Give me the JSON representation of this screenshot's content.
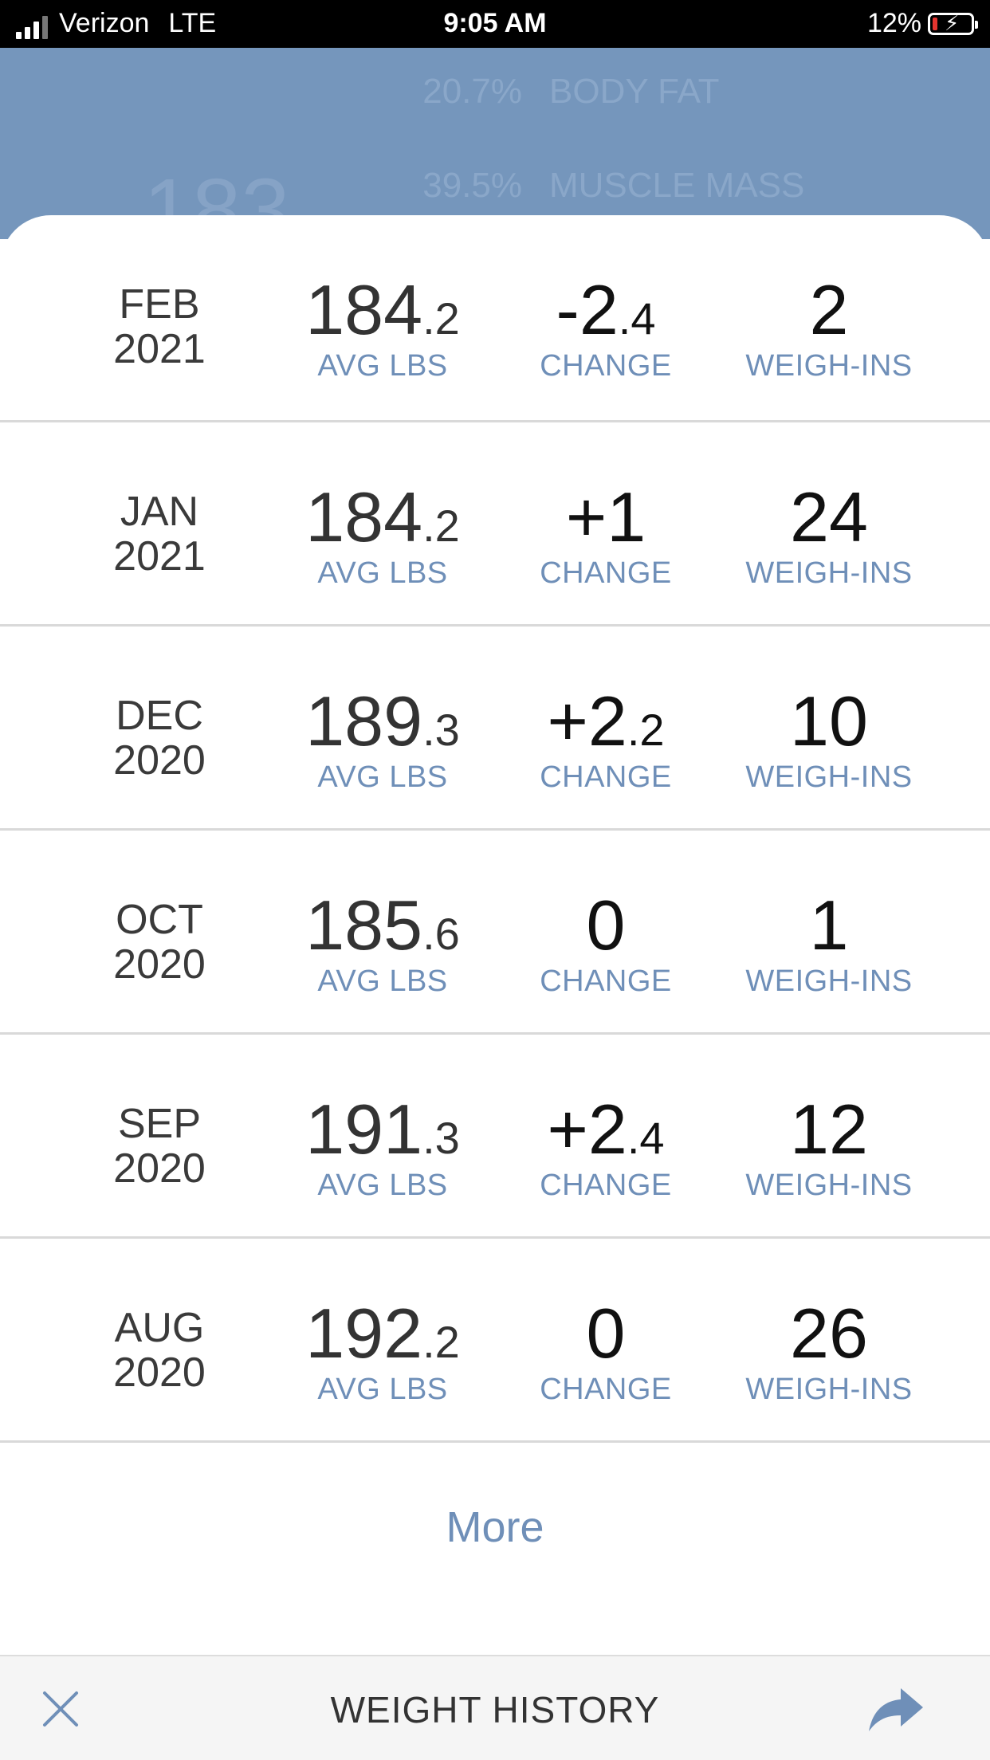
{
  "status_bar": {
    "carrier": "Verizon",
    "network": "LTE",
    "time": "9:05 AM",
    "battery": "12%",
    "icons": [
      "signal-icon",
      "battery-charging-icon"
    ]
  },
  "header": {
    "body_fat_pct": "20.7%",
    "body_fat_label": "BODY FAT",
    "muscle_mass_pct": "39.5%",
    "muscle_mass_label": "MUSCLE MASS",
    "current_weight": "183"
  },
  "history": {
    "avg_label": "AVG LBS",
    "change_label": "CHANGE",
    "weighins_label": "WEIGH-INS",
    "rows": [
      {
        "month": "FEB",
        "year": "2021",
        "avg_int": "184",
        "avg_dec": ".2",
        "change_int": "-2",
        "change_dec": ".4",
        "weighins": "2"
      },
      {
        "month": "JAN",
        "year": "2021",
        "avg_int": "184",
        "avg_dec": ".2",
        "change_int": "+1",
        "change_dec": "",
        "weighins": "24"
      },
      {
        "month": "DEC",
        "year": "2020",
        "avg_int": "189",
        "avg_dec": ".3",
        "change_int": "+2",
        "change_dec": ".2",
        "weighins": "10"
      },
      {
        "month": "OCT",
        "year": "2020",
        "avg_int": "185",
        "avg_dec": ".6",
        "change_int": "0",
        "change_dec": "",
        "weighins": "1"
      },
      {
        "month": "SEP",
        "year": "2020",
        "avg_int": "191",
        "avg_dec": ".3",
        "change_int": "+2",
        "change_dec": ".4",
        "weighins": "12"
      },
      {
        "month": "AUG",
        "year": "2020",
        "avg_int": "192",
        "avg_dec": ".2",
        "change_int": "0",
        "change_dec": "",
        "weighins": "26"
      }
    ],
    "more_label": "More"
  },
  "bottom_bar": {
    "title": "WEIGHT HISTORY",
    "icons": [
      "close-icon",
      "share-icon"
    ]
  },
  "colors": {
    "accent": "#6f8fb8",
    "header_bg": "#7596bc"
  }
}
